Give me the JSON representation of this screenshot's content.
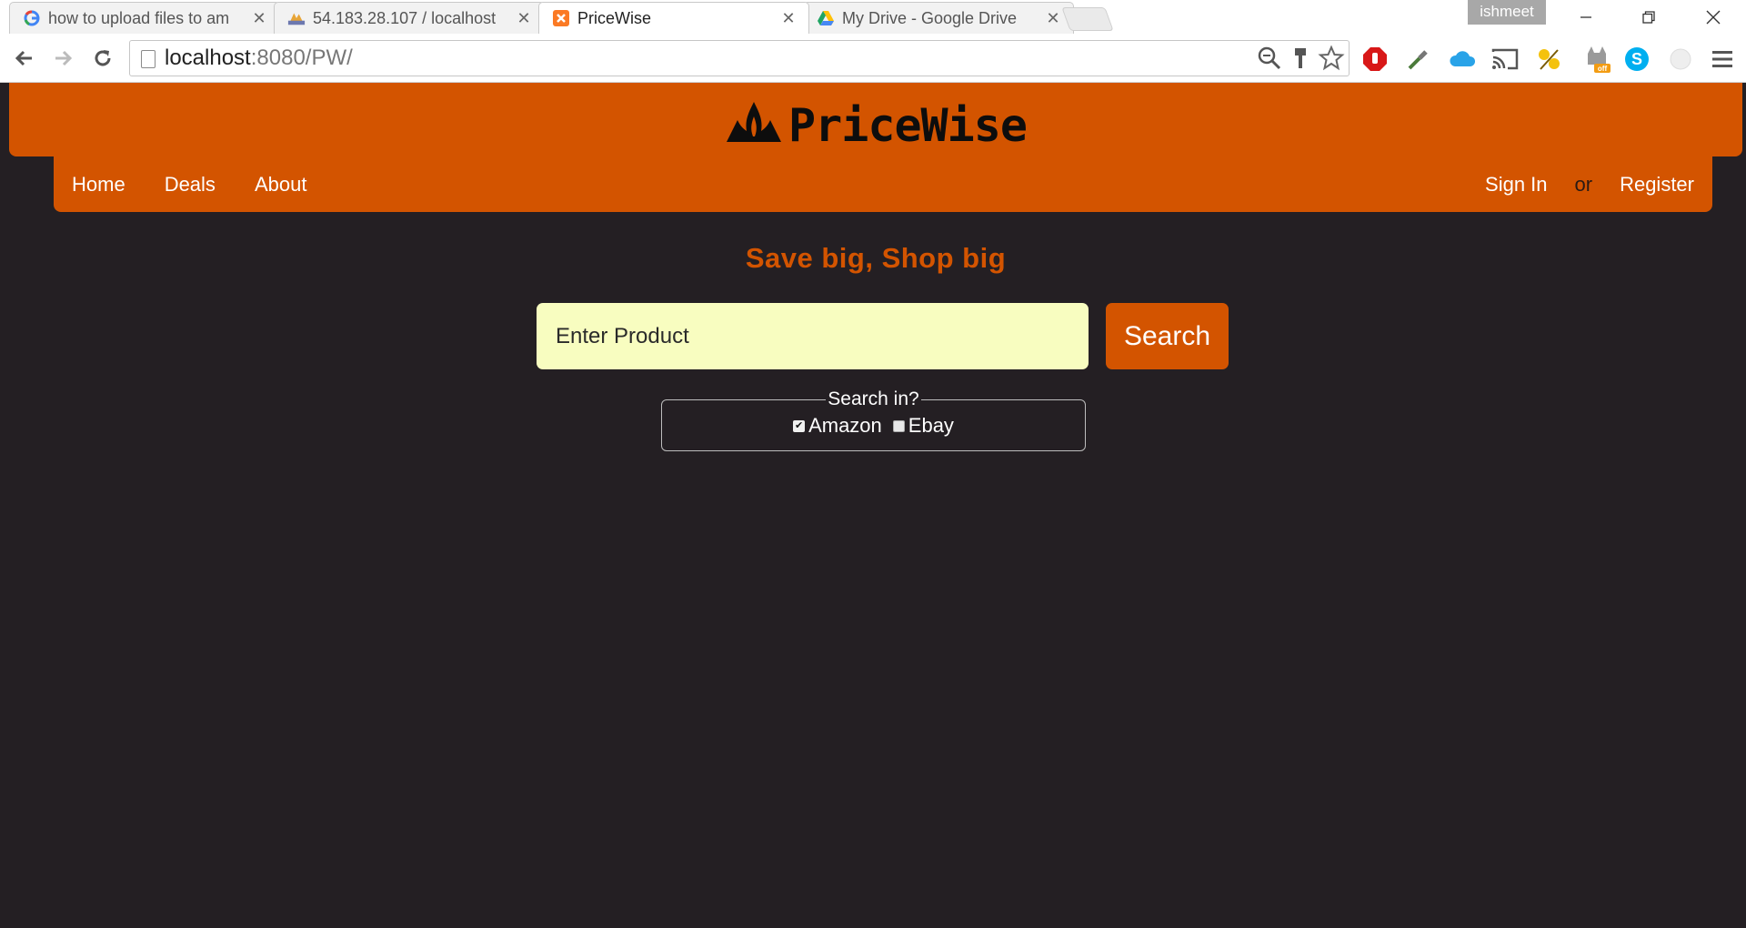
{
  "browser": {
    "tabs": [
      {
        "title": "how to upload files to am",
        "icon": "google-icon"
      },
      {
        "title": "54.183.28.107 / localhost",
        "icon": "phpmyadmin-icon"
      },
      {
        "title": "PriceWise",
        "icon": "xampp-icon",
        "active": true
      },
      {
        "title": "My Drive - Google Drive",
        "icon": "google-drive-icon"
      }
    ],
    "profile_name": "ishmeet",
    "url_host": "localhost",
    "url_path": ":8080/PW/"
  },
  "site": {
    "brand": "PriceWise",
    "nav": {
      "home": "Home",
      "deals": "Deals",
      "about": "About",
      "sign_in": "Sign In",
      "or": "or",
      "register": "Register"
    },
    "tagline": "Save big, Shop big",
    "search": {
      "placeholder": "Enter Product",
      "value": "",
      "button": "Search"
    },
    "sources": {
      "legend": "Search in?",
      "amazon": {
        "label": "Amazon",
        "checked": true
      },
      "ebay": {
        "label": "Ebay",
        "checked": false
      }
    },
    "colors": {
      "accent": "#d35400",
      "background": "#241f23",
      "input_bg": "#f8fdc0"
    }
  }
}
